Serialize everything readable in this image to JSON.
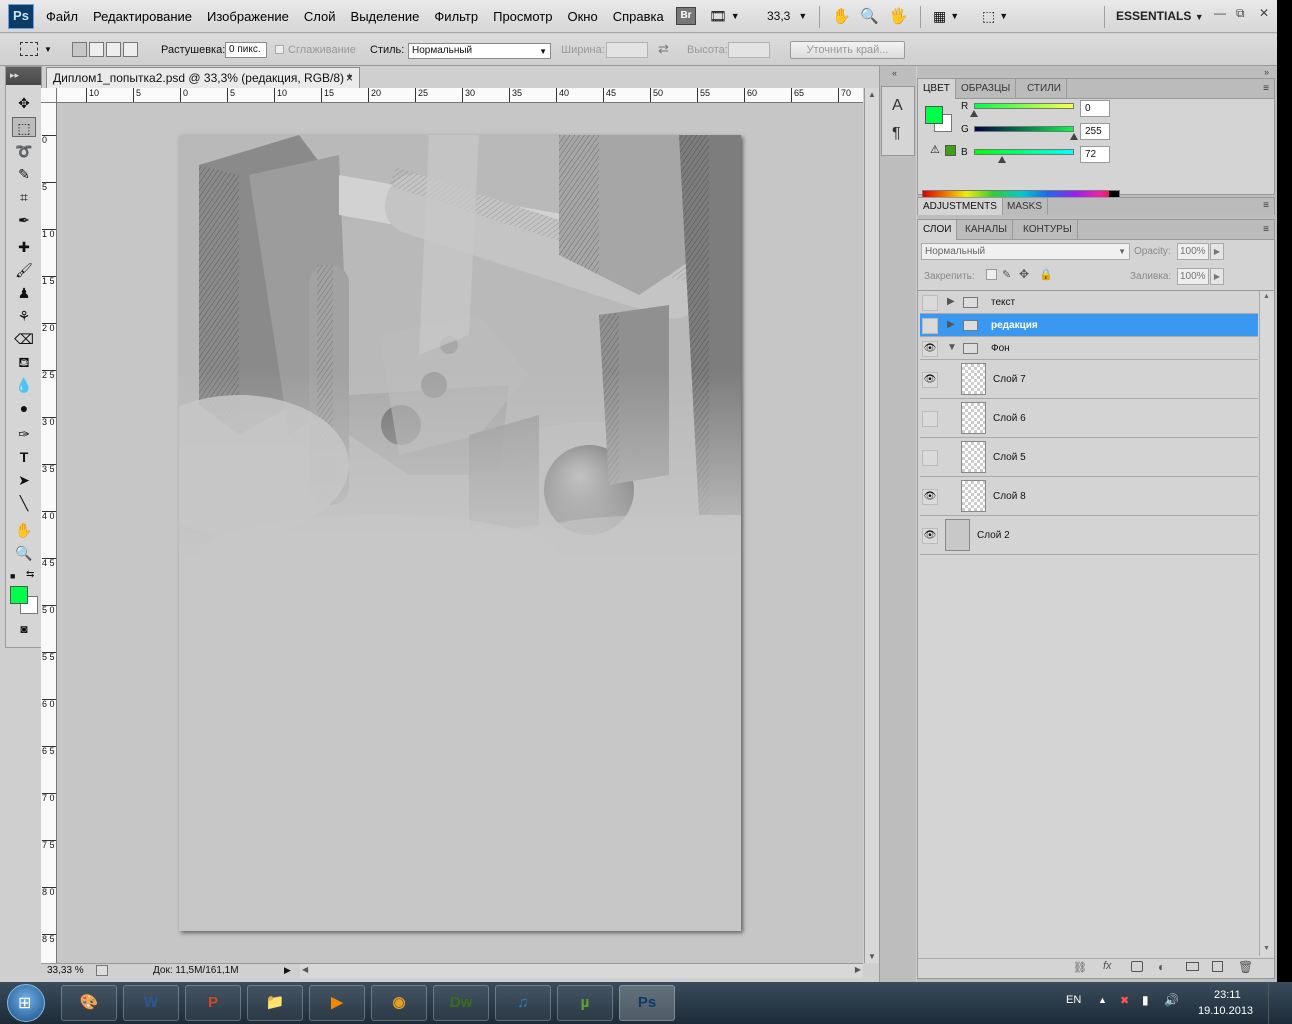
{
  "app": {
    "logo": "Ps"
  },
  "menu": [
    "Файл",
    "Редактирование",
    "Изображение",
    "Слой",
    "Выделение",
    "Фильтр",
    "Просмотр",
    "Окно",
    "Справка"
  ],
  "appbar": {
    "bridge": "Br",
    "zoom": "33,3",
    "workspace": "ESSENTIALS",
    "win_min": "—",
    "win_restore": "⧉",
    "win_close": "✕"
  },
  "options": {
    "feather_label": "Растушевка:",
    "feather_value": "0 пикс.",
    "antialias_label": "Сглаживание",
    "style_label": "Стиль:",
    "style_value": "Нормальный",
    "width_label": "Ширина:",
    "height_label": "Высота:",
    "refine_label": "Уточнить край..."
  },
  "document": {
    "tab_title": "Диплом1_попытка2.psd @ 33,3% (редакция, RGB/8) *",
    "close": "×"
  },
  "rulers": {
    "top": [
      "10",
      "5",
      "0",
      "5",
      "10",
      "15",
      "20",
      "25",
      "30",
      "35",
      "40",
      "45",
      "50",
      "55",
      "60",
      "65",
      "70"
    ],
    "left": [
      "0",
      "5",
      "1 0",
      "1 5",
      "2 0",
      "2 5",
      "3 0",
      "3 5",
      "4 0",
      "4 5",
      "5 0",
      "5 5",
      "6 0",
      "6 5",
      "7 0",
      "7 5",
      "8 0",
      "8 5"
    ]
  },
  "status": {
    "zoom": "33,33 %",
    "doc": "Док: 11,5M/161,1M"
  },
  "colors": {
    "foreground": "#00ff48",
    "background": "#ffffff",
    "selection": "#3a98f1",
    "mini_swatch": "#3fa017"
  },
  "color_panel": {
    "tabs": [
      "ЦВЕТ",
      "ОБРАЗЦЫ",
      "СТИЛИ"
    ],
    "channels": [
      {
        "label": "R",
        "value": "0",
        "fraction": 0.0
      },
      {
        "label": "G",
        "value": "255",
        "fraction": 1.0
      },
      {
        "label": "B",
        "value": "72",
        "fraction": 0.28
      }
    ]
  },
  "adjust_panel": {
    "tabs": [
      "ADJUSTMENTS",
      "MASKS"
    ]
  },
  "layers_panel": {
    "tabs": [
      "СЛОИ",
      "КАНАЛЫ",
      "КОНТУРЫ"
    ],
    "blend_mode": "Нормальный",
    "opacity_label": "Opacity:",
    "opacity_value": "100%",
    "lock_label": "Закрепить:",
    "fill_label": "Заливка:",
    "fill_value": "100%",
    "layers": [
      {
        "name": "текст",
        "type": "group",
        "visible": false,
        "expanded": false,
        "selected": false
      },
      {
        "name": "редакция",
        "type": "group",
        "visible": false,
        "expanded": false,
        "selected": true
      },
      {
        "name": "Фон",
        "type": "group",
        "visible": true,
        "expanded": true,
        "selected": false
      },
      {
        "name": "Слой 7",
        "type": "layer",
        "visible": true,
        "indent": true
      },
      {
        "name": "Слой 6",
        "type": "layer",
        "visible": false,
        "indent": true
      },
      {
        "name": "Слой 5",
        "type": "layer",
        "visible": false,
        "indent": true
      },
      {
        "name": "Слой 8",
        "type": "layer",
        "visible": true,
        "indent": true
      },
      {
        "name": "Слой 2",
        "type": "layer",
        "visible": true,
        "indent": false
      }
    ]
  },
  "taskbar": {
    "apps": [
      {
        "name": "paint",
        "glyph": "🎨"
      },
      {
        "name": "word",
        "glyph": "W"
      },
      {
        "name": "powerpoint",
        "glyph": "P"
      },
      {
        "name": "explorer",
        "glyph": "📁"
      },
      {
        "name": "media-player",
        "glyph": "▶"
      },
      {
        "name": "chrome",
        "glyph": "◉"
      },
      {
        "name": "dreamweaver",
        "glyph": "Dw"
      },
      {
        "name": "itunes",
        "glyph": "♫"
      },
      {
        "name": "utorrent",
        "glyph": "µ"
      },
      {
        "name": "photoshop",
        "glyph": "Ps"
      }
    ],
    "lang": "EN",
    "time": "23:11",
    "date": "19.10.2013"
  }
}
